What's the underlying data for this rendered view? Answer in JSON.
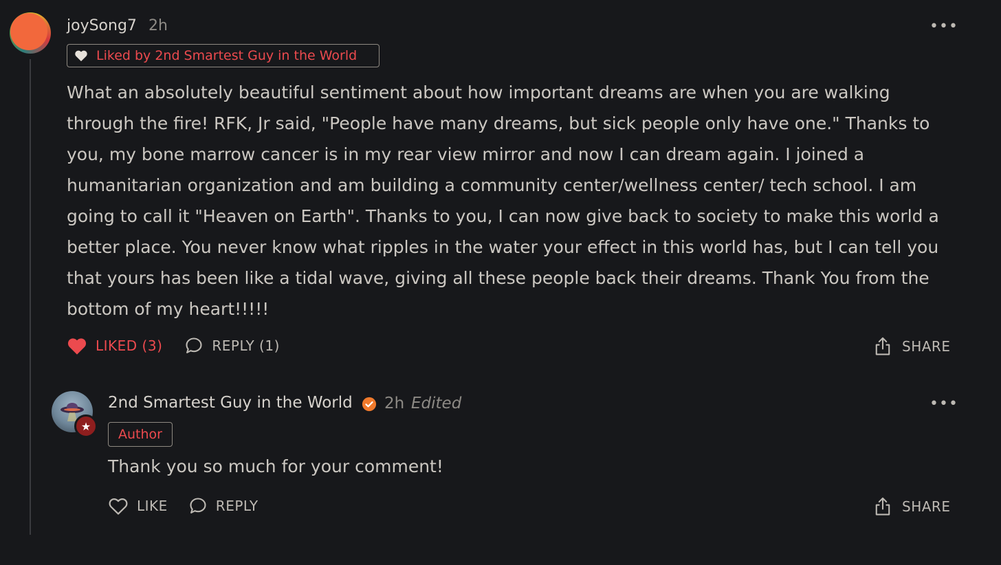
{
  "comment": {
    "author": "joySong7",
    "time": "2h",
    "liked_by_badge": "Liked by 2nd Smartest Guy in the World",
    "body": "What an absolutely beautiful sentiment about how important dreams are when you are walking through the fire! RFK, Jr said, \"People have many dreams, but sick people only have one.\" Thanks to you, my bone marrow cancer is in my rear view mirror and now I can dream again. I joined a humanitarian organization and am building a community center/wellness center/ tech school. I am going to call it \"Heaven on Earth\". Thanks to you, I can now give back to society to make this world a better place. You never know what ripples in the water your effect in this world has, but I can tell you that yours has been like a tidal wave, giving all these people back their dreams. Thank You from the bottom of my heart!!!!!",
    "actions": {
      "liked_label": "LIKED (3)",
      "reply_label": "REPLY (1)",
      "share_label": "SHARE"
    },
    "more_label": "•••"
  },
  "reply": {
    "author": "2nd Smartest Guy in the World",
    "time": "2h",
    "edited": "Edited",
    "author_badge": "Author",
    "body": "Thank you so much for your comment!",
    "actions": {
      "like_label": "LIKE",
      "reply_label": "REPLY",
      "share_label": "SHARE"
    },
    "more_label": "•••"
  },
  "colors": {
    "background": "#17181b",
    "accent_red": "#ec4a4e",
    "verified_orange": "#f07a2c",
    "text": "#cbc7c1",
    "muted": "#8d8a85"
  },
  "icons": {
    "liked": "heart-filled-icon",
    "like": "heart-outline-icon",
    "reply": "speech-bubble-icon",
    "share": "share-upload-icon",
    "more": "more-dots-icon",
    "verified": "verified-check-icon"
  }
}
